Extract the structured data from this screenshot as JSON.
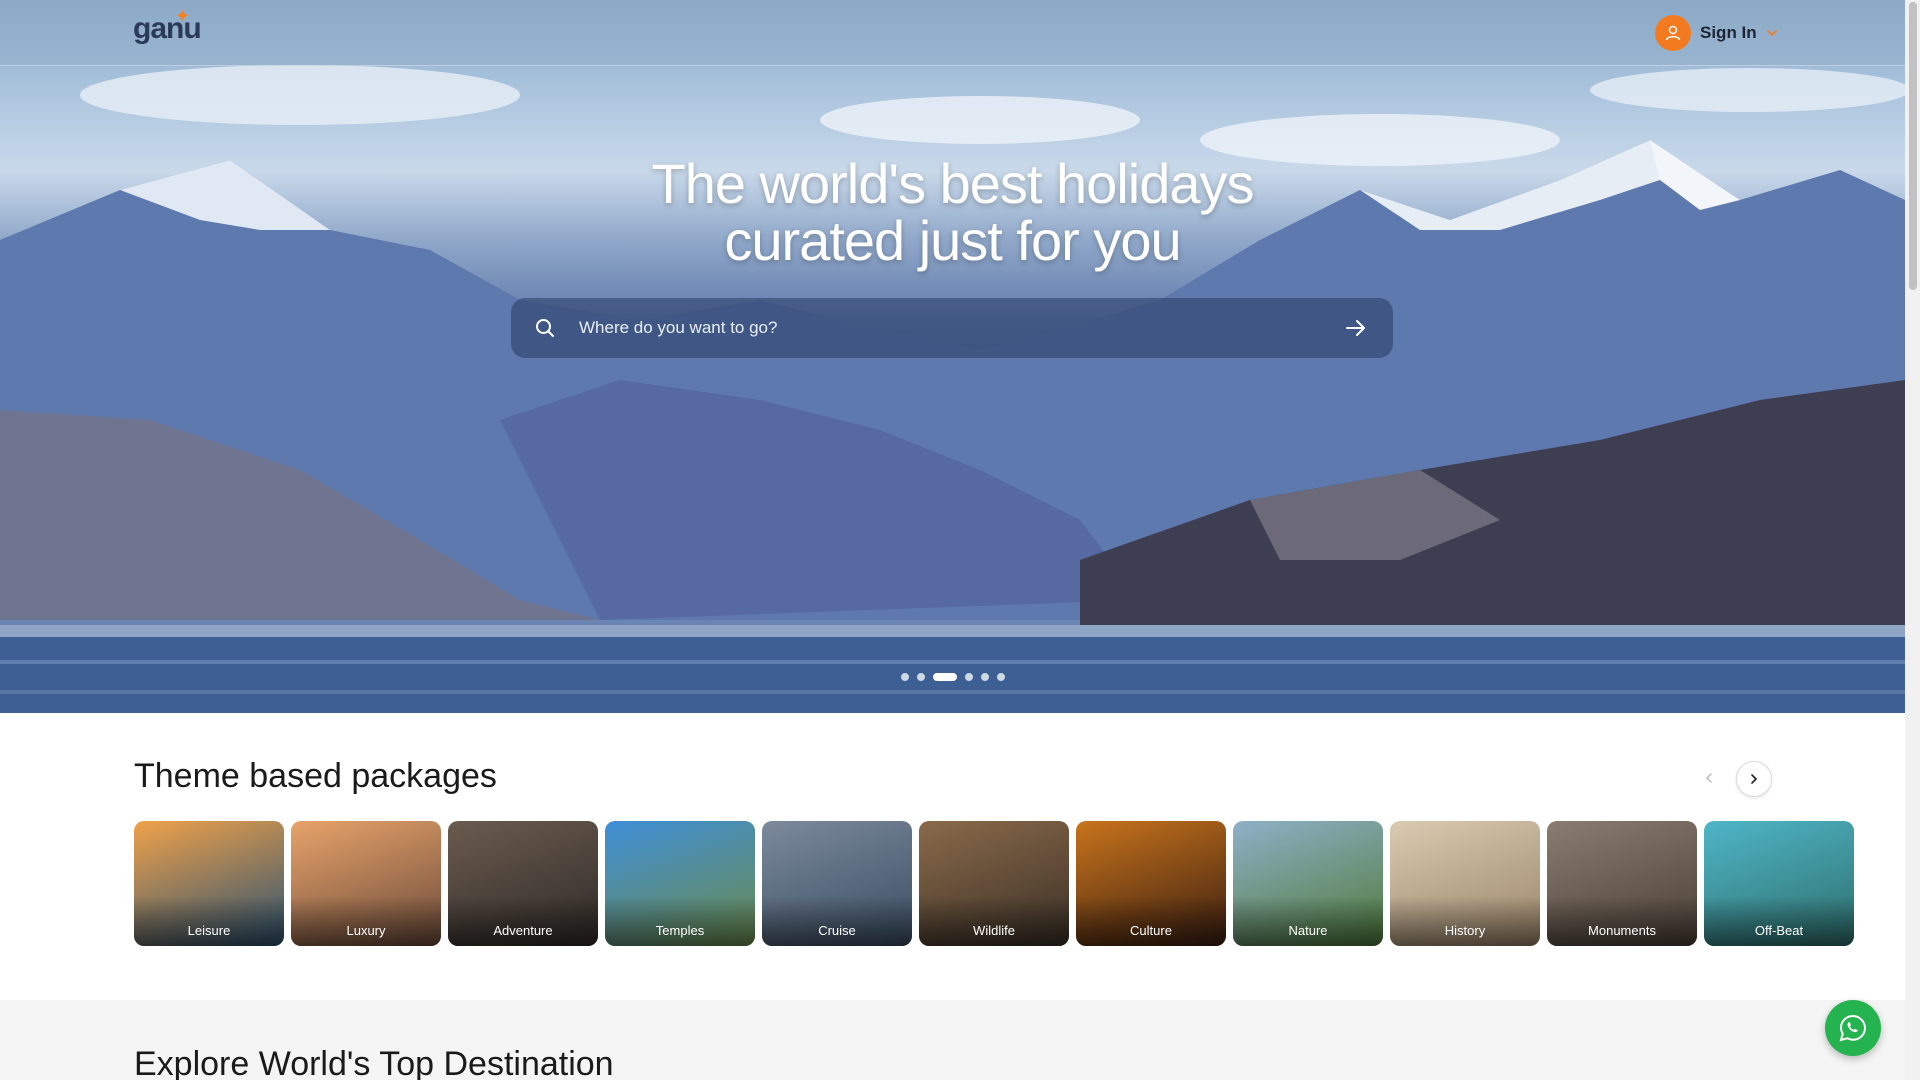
{
  "header": {
    "logo_text": "ganu",
    "signin_label": "Sign In",
    "accent_color": "#f47a1f"
  },
  "hero": {
    "headline_line1": "The world's best holidays",
    "headline_line2": "curated just for you",
    "search_placeholder": "Where do you want to go?",
    "carousel_dot_count": 6,
    "carousel_active_index": 2
  },
  "themes_section": {
    "title": "Theme based packages",
    "items": [
      {
        "label": "Leisure",
        "colors": [
          "#f0a24a",
          "#2a5170"
        ]
      },
      {
        "label": "Luxury",
        "colors": [
          "#e8a36a",
          "#6a4b3a"
        ]
      },
      {
        "label": "Adventure",
        "colors": [
          "#6b5b4f",
          "#2e2a27"
        ]
      },
      {
        "label": "Temples",
        "colors": [
          "#3f8ed8",
          "#6b8c4c"
        ]
      },
      {
        "label": "Cruise",
        "colors": [
          "#7c8a9c",
          "#3a4d62"
        ]
      },
      {
        "label": "Wildlife",
        "colors": [
          "#8a6a4a",
          "#3a3026"
        ]
      },
      {
        "label": "Culture",
        "colors": [
          "#c8741c",
          "#3a1e10"
        ]
      },
      {
        "label": "Nature",
        "colors": [
          "#8fb0c8",
          "#4e7a3a"
        ]
      },
      {
        "label": "History",
        "colors": [
          "#d9cbb2",
          "#9a8468"
        ]
      },
      {
        "label": "Monuments",
        "colors": [
          "#8a7c70",
          "#4a3f36"
        ]
      },
      {
        "label": "Off-Beat",
        "colors": [
          "#4fb6c8",
          "#2e6e6a"
        ]
      }
    ]
  },
  "explore_section": {
    "title": "Explore World's Top Destination"
  }
}
